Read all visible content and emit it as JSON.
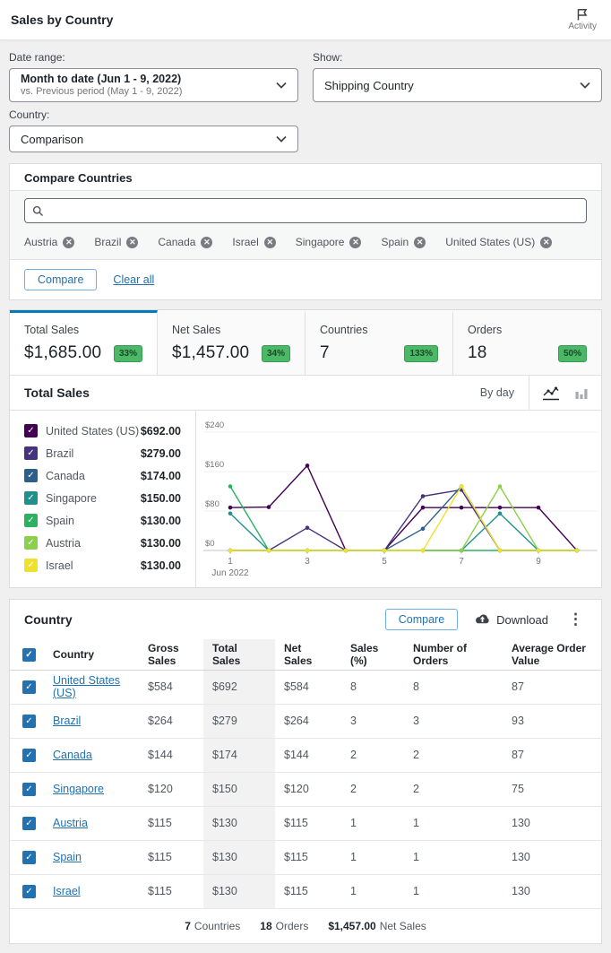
{
  "header": {
    "title": "Sales by Country",
    "activity_label": "Activity"
  },
  "filters": {
    "date_range_label": "Date range:",
    "date_range_value": "Month to date (Jun 1 - 9, 2022)",
    "date_range_compare": "vs. Previous period (May 1 - 9, 2022)",
    "show_label": "Show:",
    "show_value": "Shipping Country",
    "country_label": "Country:",
    "country_value": "Comparison"
  },
  "compare_panel": {
    "title": "Compare Countries",
    "search_placeholder": "",
    "chips": [
      "Austria",
      "Brazil",
      "Canada",
      "Israel",
      "Singapore",
      "Spain",
      "United States (US)"
    ],
    "compare_button": "Compare",
    "clear_all_label": "Clear all"
  },
  "summary_tabs": [
    {
      "label": "Total Sales",
      "value": "$1,685.00",
      "delta": "33%"
    },
    {
      "label": "Net Sales",
      "value": "$1,457.00",
      "delta": "34%"
    },
    {
      "label": "Countries",
      "value": "7",
      "delta": "133%"
    },
    {
      "label": "Orders",
      "value": "18",
      "delta": "50%"
    }
  ],
  "delta_badge_color": "#4ab866",
  "accent_color": "#2271b1",
  "active_tab_indicator_color": "#007cba",
  "chart_section": {
    "title": "Total Sales",
    "interval_label": "By day"
  },
  "chart_data": {
    "type": "line",
    "title": "Total Sales",
    "interval": "By day",
    "x": [
      1,
      2,
      3,
      4,
      5,
      6,
      7,
      8,
      9,
      10
    ],
    "x_tick_labels": [
      1,
      3,
      5,
      7,
      9
    ],
    "x_axis_annotation": "Jun 2022",
    "ylim": [
      0,
      240
    ],
    "ytick_labels": [
      "$0",
      "$80",
      "$160",
      "$240"
    ],
    "grid": true,
    "legend_position": "left",
    "series": [
      {
        "name": "United States (US)",
        "legend_total": "$692.00",
        "color": "#440154",
        "values": [
          87,
          88,
          172,
          0,
          0,
          87,
          87,
          87,
          87,
          0
        ]
      },
      {
        "name": "Brazil",
        "legend_total": "$279.00",
        "color": "#46327e",
        "values": [
          0,
          0,
          46,
          0,
          0,
          110,
          123,
          0,
          0,
          0
        ]
      },
      {
        "name": "Canada",
        "legend_total": "$174.00",
        "color": "#2c5f8a",
        "values": [
          0,
          0,
          0,
          0,
          0,
          44,
          130,
          0,
          0,
          0
        ]
      },
      {
        "name": "Singapore",
        "legend_total": "$150.00",
        "color": "#1f918c",
        "values": [
          75,
          0,
          0,
          0,
          0,
          0,
          0,
          75,
          0,
          0
        ]
      },
      {
        "name": "Spain",
        "legend_total": "$130.00",
        "color": "#2bb261",
        "values": [
          130,
          0,
          0,
          0,
          0,
          0,
          0,
          0,
          0,
          0
        ]
      },
      {
        "name": "Austria",
        "legend_total": "$130.00",
        "color": "#8bd04a",
        "values": [
          0,
          0,
          0,
          0,
          0,
          0,
          0,
          130,
          0,
          0
        ]
      },
      {
        "name": "Israel",
        "legend_total": "$130.00",
        "color": "#f0e12f",
        "values": [
          0,
          0,
          0,
          0,
          0,
          0,
          130,
          0,
          0,
          0
        ]
      }
    ]
  },
  "table": {
    "title": "Country",
    "compare_button": "Compare",
    "download_label": "Download",
    "columns": [
      "Country",
      "Gross Sales",
      "Total Sales",
      "Net Sales",
      "Sales (%)",
      "Number of Orders",
      "Average Order Value"
    ],
    "sorted_column": "Total Sales",
    "rows": [
      {
        "country": "United States (US)",
        "cells": [
          "$584",
          "$692",
          "$584",
          "8",
          "8",
          "87"
        ]
      },
      {
        "country": "Brazil",
        "cells": [
          "$264",
          "$279",
          "$264",
          "3",
          "3",
          "93"
        ]
      },
      {
        "country": "Canada",
        "cells": [
          "$144",
          "$174",
          "$144",
          "2",
          "2",
          "87"
        ]
      },
      {
        "country": "Singapore",
        "cells": [
          "$120",
          "$150",
          "$120",
          "2",
          "2",
          "75"
        ]
      },
      {
        "country": "Austria",
        "cells": [
          "$115",
          "$130",
          "$115",
          "1",
          "1",
          "130"
        ]
      },
      {
        "country": "Spain",
        "cells": [
          "$115",
          "$130",
          "$115",
          "1",
          "1",
          "130"
        ]
      },
      {
        "country": "Israel",
        "cells": [
          "$115",
          "$130",
          "$115",
          "1",
          "1",
          "130"
        ]
      }
    ],
    "summary": [
      {
        "value": "7",
        "label": "Countries"
      },
      {
        "value": "18",
        "label": "Orders"
      },
      {
        "value": "$1,457.00",
        "label": "Net Sales"
      }
    ]
  }
}
